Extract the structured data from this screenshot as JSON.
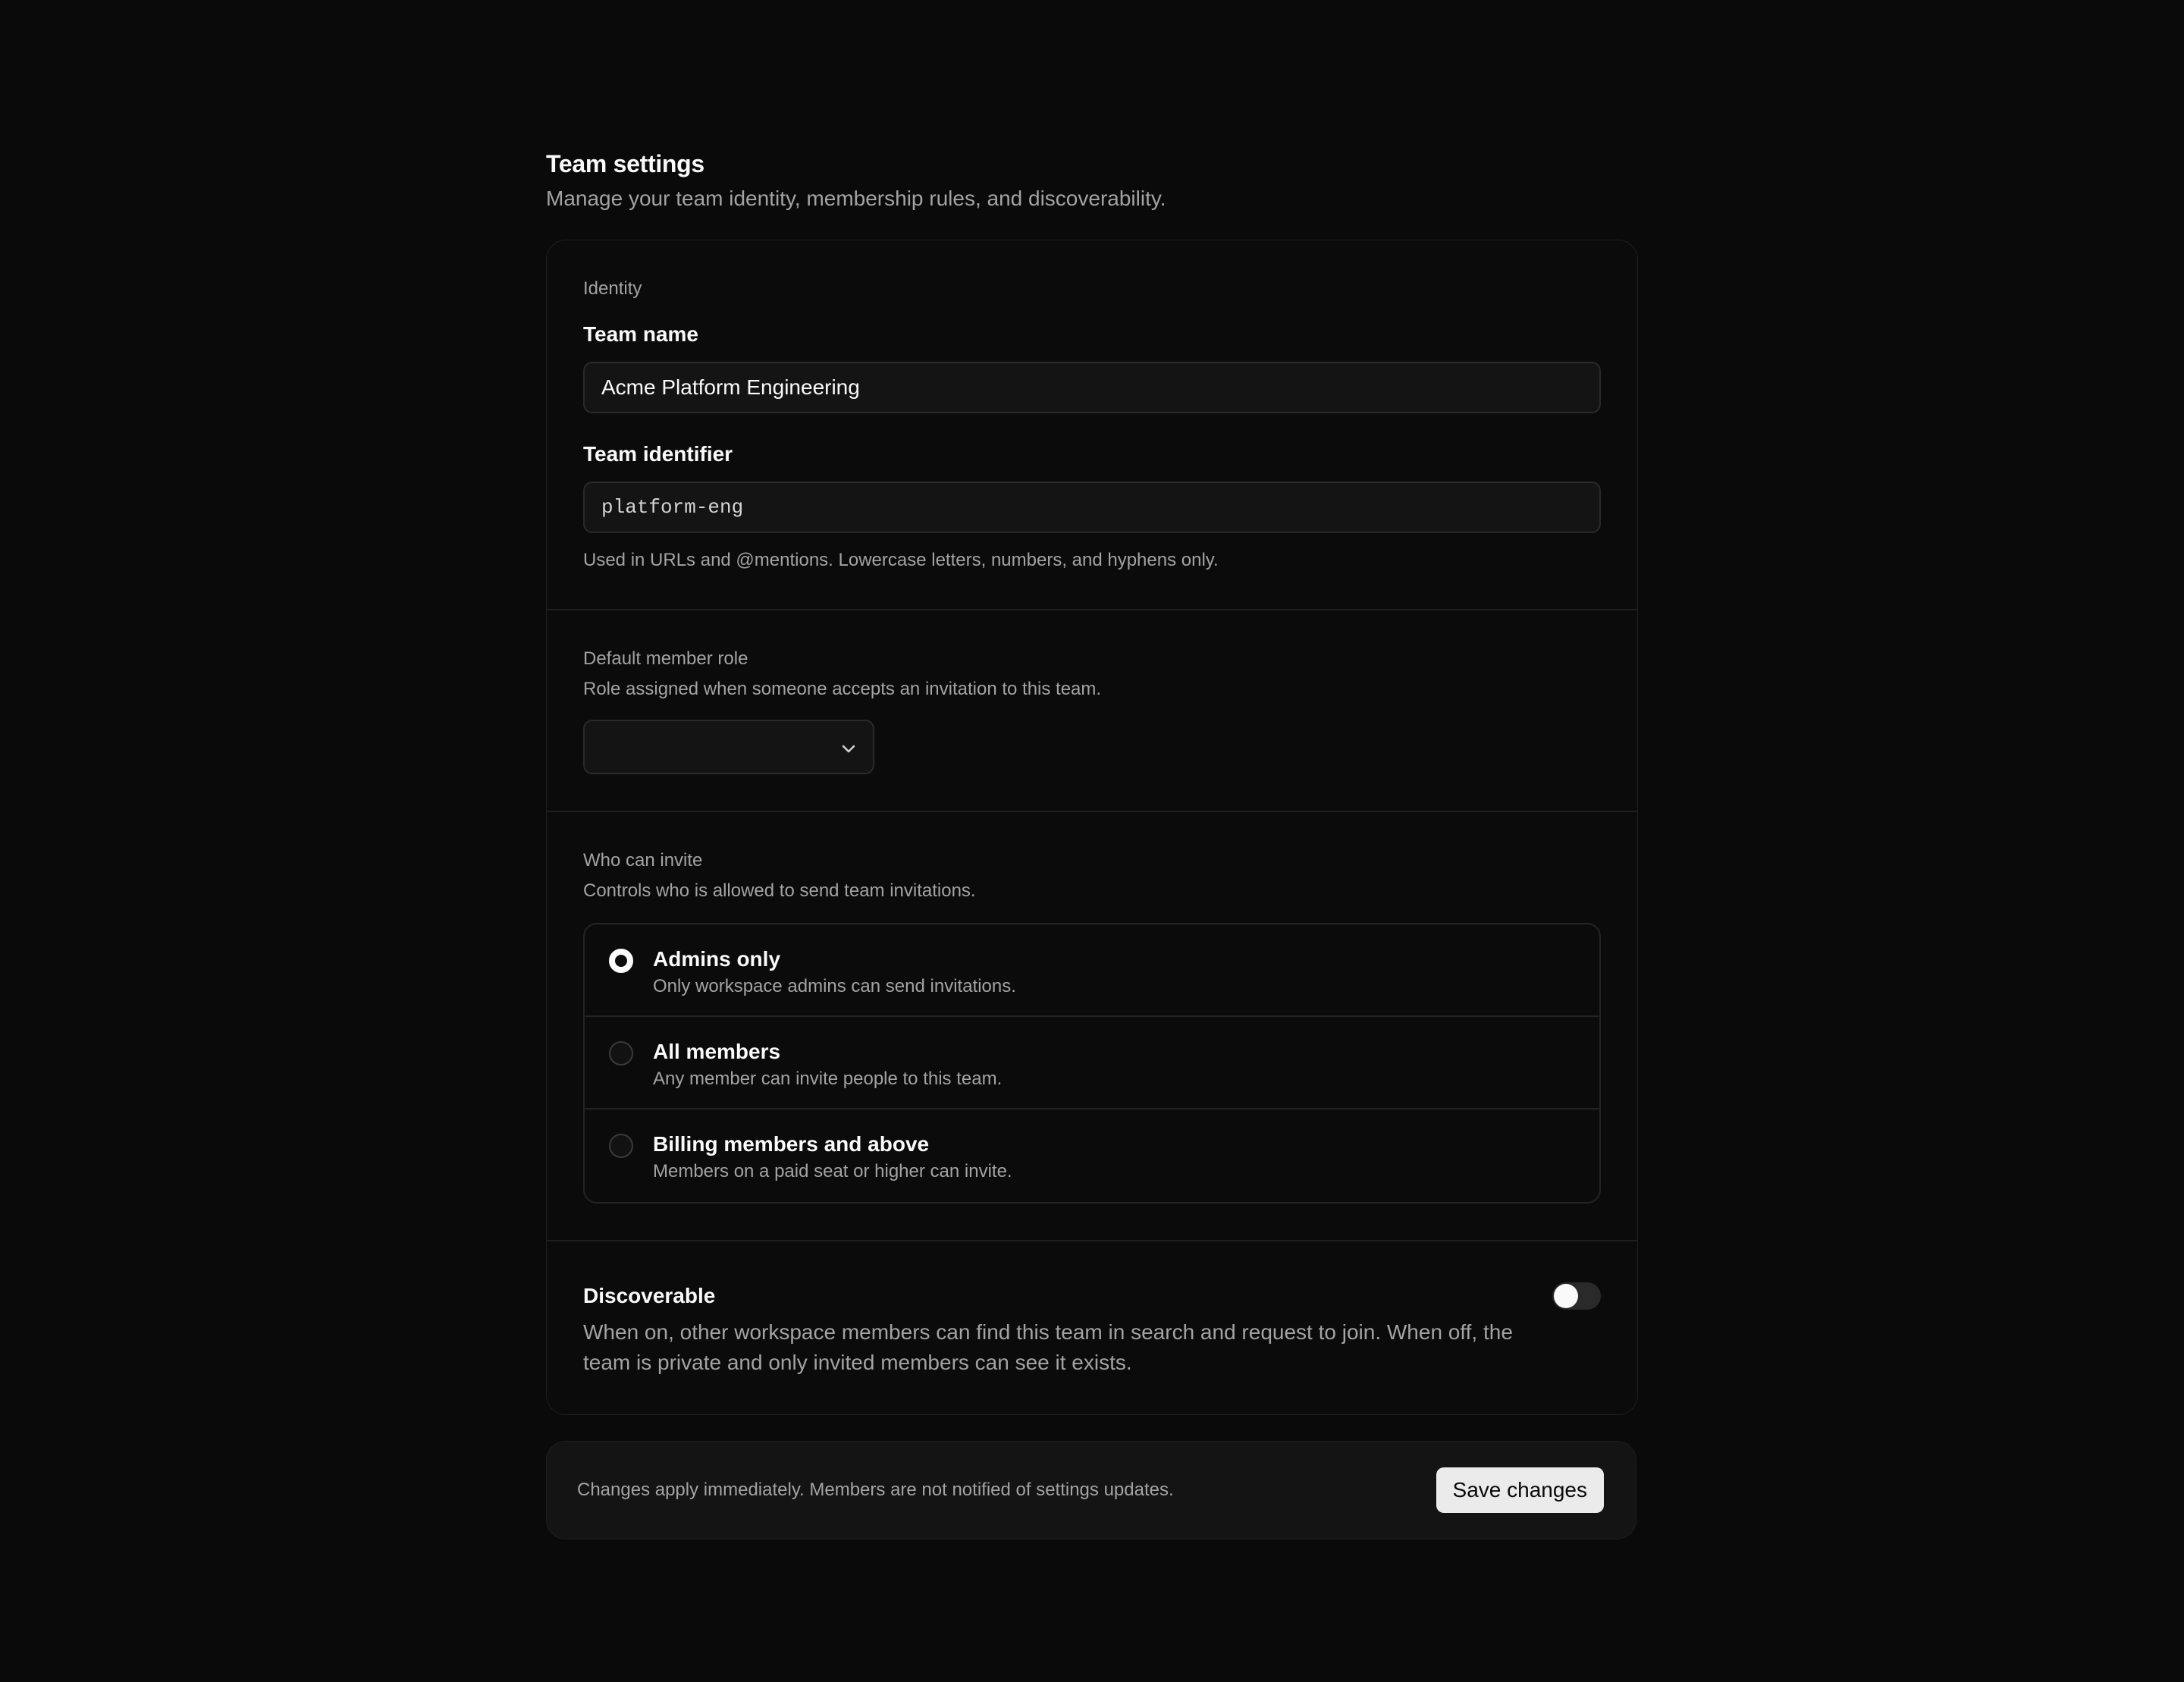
{
  "header": {
    "title": "Team settings",
    "subtitle": "Manage your team identity, membership rules, and discoverability."
  },
  "identity": {
    "section_label": "Identity",
    "team_name_label": "Team name",
    "team_name_value": "Acme Platform Engineering",
    "team_identifier_label": "Team identifier",
    "team_identifier_value": "platform-eng",
    "team_identifier_hint": "Used in URLs and @mentions. Lowercase letters, numbers, and hyphens only."
  },
  "default_role": {
    "section_label": "Default member role",
    "help": "Role assigned when someone accepts an invitation to this team.",
    "selected_value": "",
    "icon": "chevron-down-icon"
  },
  "who_can_invite": {
    "section_label": "Who can invite",
    "help": "Controls who is allowed to send team invitations.",
    "options": [
      {
        "title": "Admins only",
        "description": "Only workspace admins can send invitations.",
        "checked": true
      },
      {
        "title": "All members",
        "description": "Any member can invite people to this team.",
        "checked": false
      },
      {
        "title": "Billing members and above",
        "description": "Members on a paid seat or higher can invite.",
        "checked": false
      }
    ]
  },
  "discoverable": {
    "title": "Discoverable",
    "description": "When on, other workspace members can find this team in search and request to join. When off, the team is private and only invited members can see it exists.",
    "enabled": false
  },
  "footer": {
    "note": "Changes apply immediately. Members are not notified of settings updates.",
    "save_label": "Save changes"
  },
  "colors": {
    "background": "#0a0a0a",
    "card": "#0b0b0b",
    "border": "#1f1f1f",
    "muted_text": "#a3a3a3",
    "primary_button": "#ebebeb"
  }
}
